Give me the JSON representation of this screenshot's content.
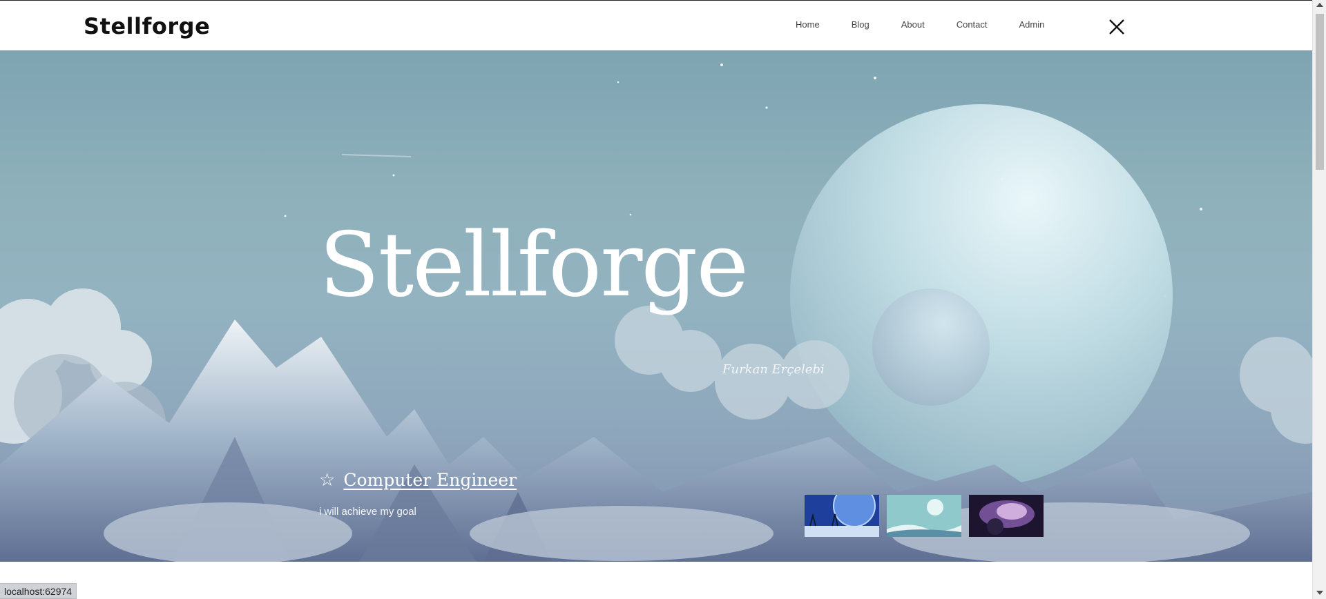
{
  "header": {
    "logo": "Stellforge",
    "nav": [
      {
        "label": "Home"
      },
      {
        "label": "Blog"
      },
      {
        "label": "About"
      },
      {
        "label": "Contact"
      },
      {
        "label": "Admin"
      }
    ],
    "close_icon": "close-icon"
  },
  "hero": {
    "title": "Stellforge",
    "signature": "Furkan Erçelebi",
    "role": "Computer Engineer",
    "role_icon": "star-outline-icon",
    "tagline": "i will achieve my goal",
    "thumbnails": [
      {
        "name": "thumbnail-blue-planet"
      },
      {
        "name": "thumbnail-ice-moon"
      },
      {
        "name": "thumbnail-nebula"
      }
    ]
  },
  "status_bar": {
    "text": "localhost:62974"
  },
  "colors": {
    "sky_top": "#7ea4b2",
    "sky_bottom": "#7f90ad",
    "planet": "#cfe7ec",
    "text_on_hero": "#ffffff"
  }
}
